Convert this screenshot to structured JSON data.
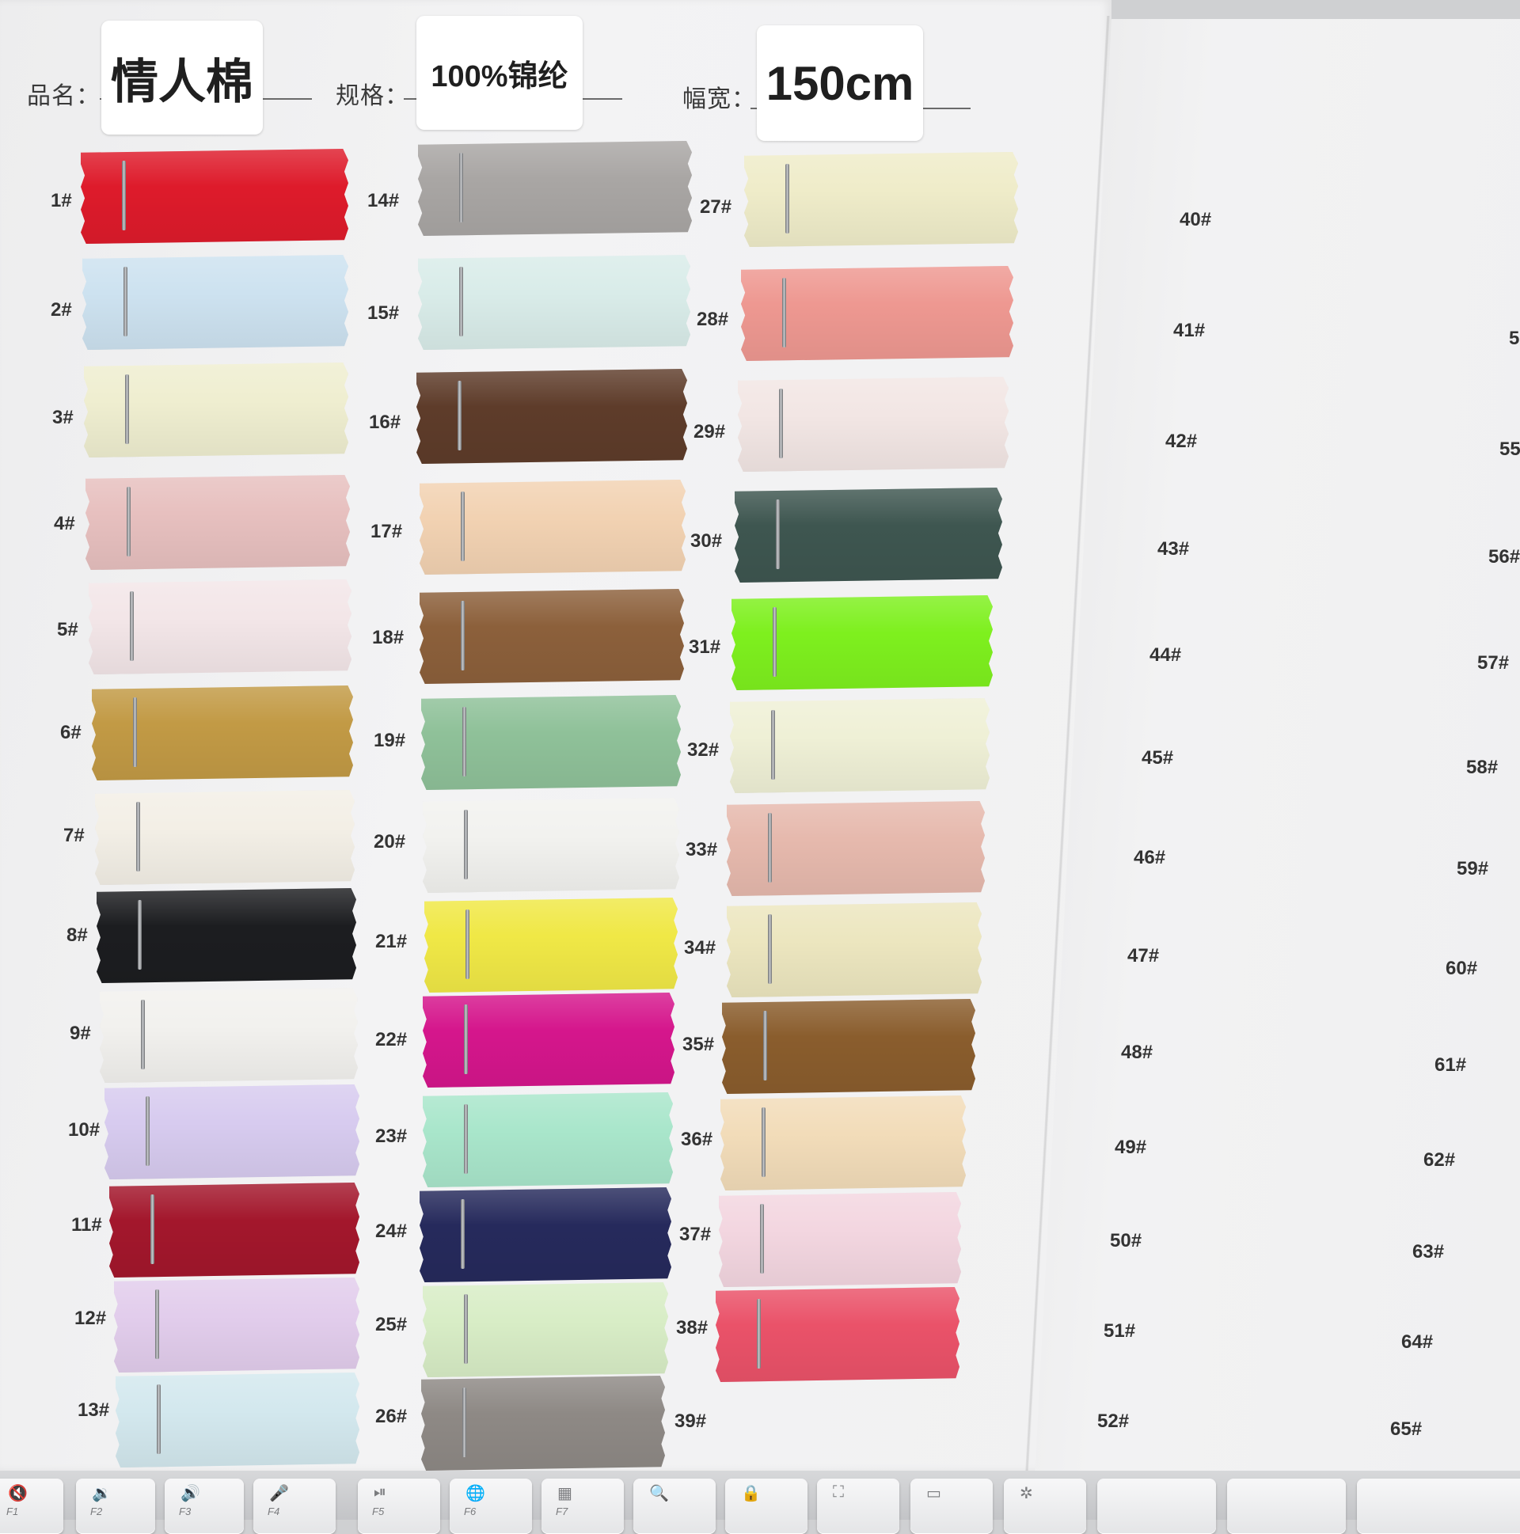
{
  "card": {
    "product_name_label": "品名：",
    "product_name_value": "情人棉",
    "spec_label": "规格：",
    "spec_value": "100%锦纶",
    "width_label": "幅宽：",
    "width_value": "150cm"
  },
  "swatch_columns": [
    {
      "left": [
        {
          "label": "1#",
          "color": "#de1b2b"
        },
        {
          "label": "2#",
          "color": "#cde2f0"
        },
        {
          "label": "3#",
          "color": "#efeed0"
        },
        {
          "label": "4#",
          "color": "#e7c0bf"
        },
        {
          "label": "5#",
          "color": "#f3e6e8"
        },
        {
          "label": "6#",
          "color": "#c29a45"
        },
        {
          "label": "7#",
          "color": "#f3efe6"
        },
        {
          "label": "8#",
          "color": "#1c1d20"
        },
        {
          "label": "9#",
          "color": "#f2f1ee"
        },
        {
          "label": "10#",
          "color": "#d7cbef"
        },
        {
          "label": "11#",
          "color": "#a3172c"
        },
        {
          "label": "12#",
          "color": "#e2cdec"
        },
        {
          "label": "13#",
          "color": "#d3e8ee"
        }
      ]
    },
    {
      "left": [
        {
          "label": "14#",
          "color": "#a9a6a4"
        },
        {
          "label": "15#",
          "color": "#d9ece9"
        },
        {
          "label": "16#",
          "color": "#5e3c2a"
        },
        {
          "label": "17#",
          "color": "#f2d2b2"
        },
        {
          "label": "18#",
          "color": "#8c603b"
        },
        {
          "label": "19#",
          "color": "#8fc199"
        },
        {
          "label": "20#",
          "color": "#f2f2ef"
        },
        {
          "label": "21#",
          "color": "#f0e846"
        },
        {
          "label": "22#",
          "color": "#d5168c"
        },
        {
          "label": "23#",
          "color": "#a9e6cb"
        },
        {
          "label": "24#",
          "color": "#262a5c"
        },
        {
          "label": "25#",
          "color": "#d8edc6"
        },
        {
          "label": "26#",
          "color": "#8e8985"
        }
      ]
    },
    {
      "left": [
        {
          "label": "27#",
          "color": "#efecc9"
        },
        {
          "label": "28#",
          "color": "#ee9891"
        },
        {
          "label": "29#",
          "color": "#f2e6e4"
        },
        {
          "label": "30#",
          "color": "#3e5650"
        },
        {
          "label": "31#",
          "color": "#7ef01e"
        },
        {
          "label": "32#",
          "color": "#eff0d6"
        },
        {
          "label": "33#",
          "color": "#e6b9ad"
        },
        {
          "label": "34#",
          "color": "#ece6bf"
        },
        {
          "label": "35#",
          "color": "#8a5d2d"
        },
        {
          "label": "36#",
          "color": "#f2dcb9"
        },
        {
          "label": "37#",
          "color": "#f3d6e0"
        },
        {
          "label": "38#",
          "color": "#ea5269"
        },
        {
          "label": "39#",
          "color": ""
        }
      ]
    }
  ],
  "empty_labels_a": [
    "40#",
    "41#",
    "42#",
    "43#",
    "44#",
    "45#",
    "46#",
    "47#",
    "48#",
    "49#",
    "50#",
    "51#",
    "52#"
  ],
  "empty_labels_b": [
    "5",
    "55",
    "56#",
    "57#",
    "58#",
    "59#",
    "60#",
    "61#",
    "62#",
    "63#",
    "64#",
    "65#"
  ],
  "keyboard": {
    "keys": [
      {
        "icon": "🔇",
        "fn": "F1"
      },
      {
        "icon": "🔉",
        "fn": "F2"
      },
      {
        "icon": "🔊",
        "fn": "F3"
      },
      {
        "icon": "🎤",
        "fn": "F4"
      },
      {
        "icon": "⏯",
        "fn": "F5"
      },
      {
        "icon": "🌐",
        "fn": "F6"
      },
      {
        "icon": "▦",
        "fn": "F7"
      },
      {
        "icon": "🔍",
        "fn": ""
      },
      {
        "icon": "🔒",
        "fn": ""
      },
      {
        "icon": "⛶",
        "fn": ""
      },
      {
        "icon": "▭",
        "fn": ""
      },
      {
        "icon": "✲",
        "fn": ""
      }
    ]
  }
}
